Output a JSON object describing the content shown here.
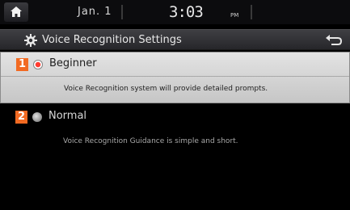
{
  "status_bar": {
    "date": "Jan.  1",
    "time": "3:03",
    "ampm": "PM"
  },
  "title_bar": {
    "title": "Voice Recognition Settings",
    "icon": "gear-icon",
    "back_icon": "back-arrow-icon"
  },
  "options": [
    {
      "number": "1",
      "label": "Beginner",
      "description": "Voice Recognition system will provide detailed prompts.",
      "selected": true
    },
    {
      "number": "2",
      "label": "Normal",
      "description": "Voice Recognition Guidance is simple and short.",
      "selected": false
    }
  ],
  "colors": {
    "badge": "#f26a22",
    "selected_radio": "#ff3b30"
  }
}
